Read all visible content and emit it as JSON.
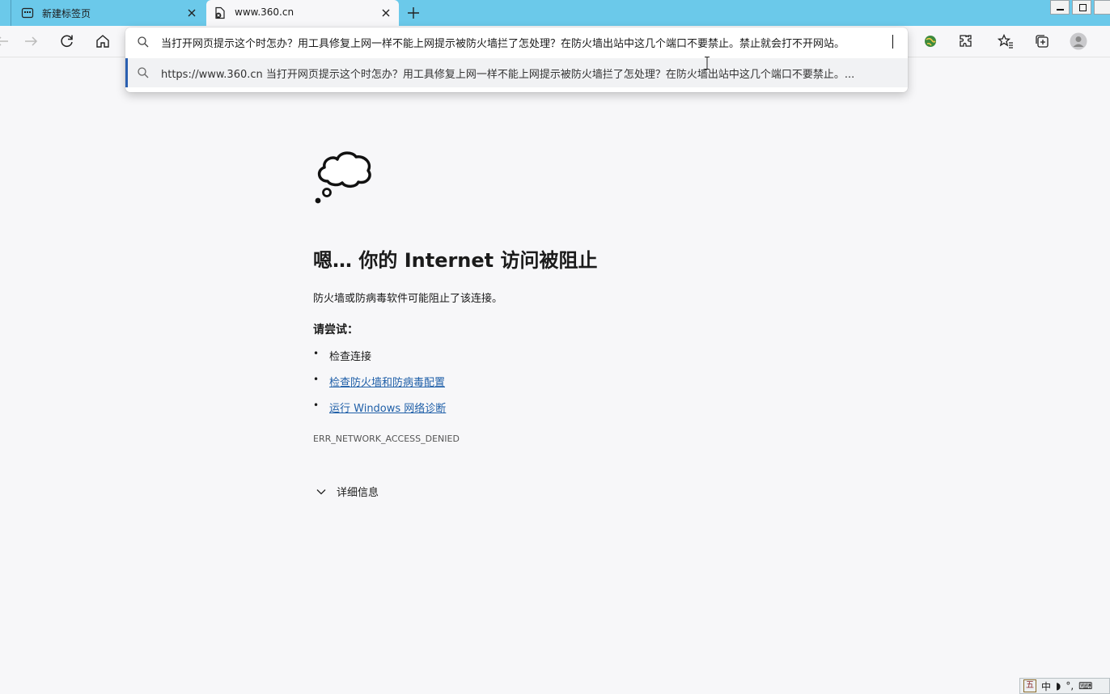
{
  "tabs": [
    {
      "title": "新建标签页",
      "icon": "new-tab-page-icon"
    },
    {
      "title": "www.360.cn",
      "icon": "blocked-page-icon"
    }
  ],
  "omnibox": {
    "input_text": "当打开网页提示这个时怎办？用工具修复上网一样不能上网提示被防火墙拦了怎处理？在防火墙出站中这几个端口不要禁止。禁止就会打不开网站。",
    "suggestion": "https://www.360.cn 当打开网页提示这个时怎办？用工具修复上网一样不能上网提示被防火墙拦了怎处理？在防火墙出站中这几个端口不要禁止。..."
  },
  "error": {
    "title": "嗯… 你的 Internet 访问被阻止",
    "description": "防火墙或防病毒软件可能阻止了该连接。",
    "try_heading": "请尝试：",
    "suggestions": [
      "检查连接",
      "检查防火墙和防病毒配置",
      "运行 Windows 网络诊断"
    ],
    "code": "ERR_NETWORK_ACCESS_DENIED",
    "details_label": "详细信息"
  },
  "ime": {
    "mode": "五",
    "lang": "中"
  },
  "colors": {
    "tabstrip": "#6bc9ea",
    "link": "#1f5fa8",
    "page_bg": "#f7f7f9"
  }
}
